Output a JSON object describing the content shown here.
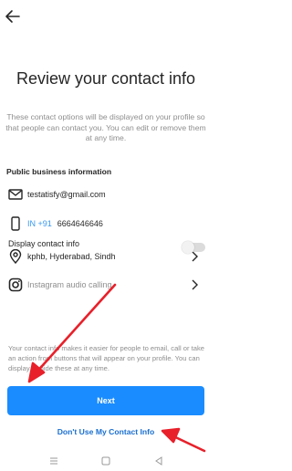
{
  "header": {
    "back_icon": "arrow-left-icon"
  },
  "main": {
    "title": "Review your contact info",
    "subtitle": "These contact options will be displayed on your profile so that people can contact you. You can edit or remove them at any time.",
    "section_heading": "Public business information",
    "contacts": [
      {
        "icon": "mail-icon",
        "value": "testatisfy@gmail.com"
      },
      {
        "icon": "phone-icon",
        "country_code": "IN +91",
        "value": "6664646646"
      },
      {
        "icon": "location-icon",
        "value": "kphb, Hyderabad, Sindh"
      },
      {
        "icon": "instagram-icon",
        "value": "Instagram audio calling"
      }
    ],
    "display_toggle": {
      "label": "Display contact info",
      "state": "off"
    },
    "info_text": "Your contact info makes it easier for people to email, call or take an action from buttons that will appear on your profile. You can display or hide these at any time."
  },
  "actions": {
    "next_label": "Next",
    "skip_label": "Don't Use My Contact Info"
  },
  "colors": {
    "primary": "#1a8cff",
    "link": "#1a6fcf",
    "annotation_arrow": "#e8202a",
    "muted_text": "#8e8e8e"
  },
  "system_nav": [
    "menu-icon",
    "home-square-icon",
    "back-triangle-icon"
  ]
}
